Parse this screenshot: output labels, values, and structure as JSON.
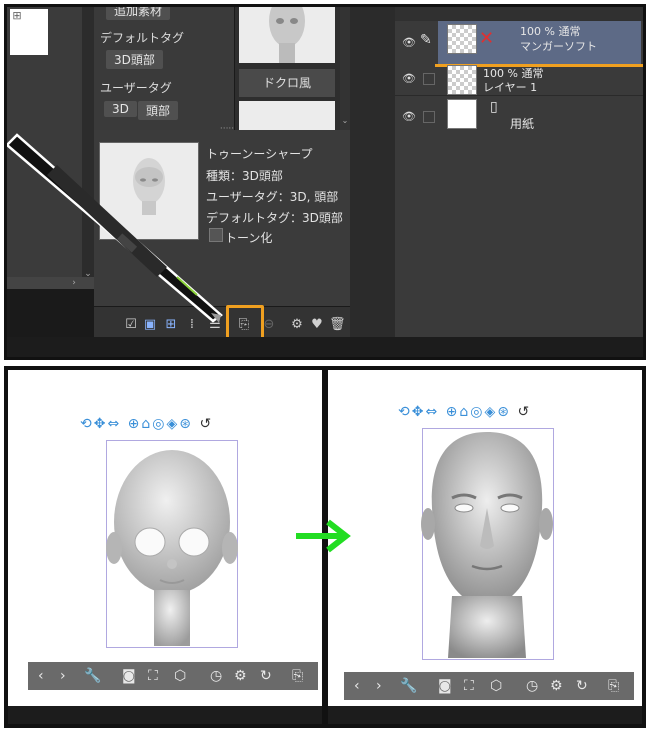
{
  "top": {
    "tags": {
      "partial_top": "追加素材",
      "default_tag_label": "デフォルトタグ",
      "default_tag_chip": "3D頭部",
      "user_tag_label": "ユーザータグ",
      "user_tag_chips": [
        "3D",
        "頭部"
      ]
    },
    "thumbnail_label": "ドクロ風",
    "detail": {
      "name": "トゥーンーシャープ",
      "type": "種類：3D頭部",
      "user_tag": "ユーザータグ：3D, 頭部",
      "default_tag": "デフォルトタグ：3D頭部",
      "tone_checkbox": "トーン化"
    },
    "layers": [
      {
        "line1": "100 % 通常",
        "line2": "マンガーソフト"
      },
      {
        "line1": "100 % 通常",
        "line2": "レイヤー 1"
      },
      {
        "line1": "用紙",
        "line2": ""
      }
    ],
    "highlight_color": "#f0a020"
  },
  "bottom": {
    "arrow_color": "#22dd22",
    "left_frame_icons": "view-rotate,pan,move,object-rotate,head,zoom,reset,sync,undo",
    "right_frame_icons": "view-rotate,pan,move,object-rotate,head,zoom,reset,sync,undo"
  }
}
